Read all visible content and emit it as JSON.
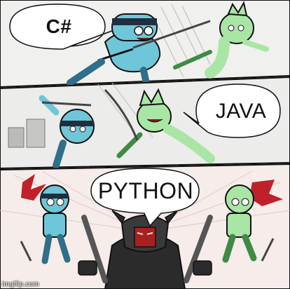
{
  "panels": [
    {
      "bubble_text": "C#"
    },
    {
      "bubble_text": "JAVA"
    },
    {
      "bubble_text": "PYTHON"
    }
  ],
  "watermark": "imgflip.com",
  "colors": {
    "panel_top_bg": "#f0f0ee",
    "panel_mid_bg": "#ececea",
    "panel_bottom_bg": "#f6ece9",
    "blue_character": "#6fc6d8",
    "blue_character_dark": "#2f6f8a",
    "green_character": "#a9e6a6",
    "green_character_dark": "#3f8a44",
    "ninja_mask": "#1f2f3f",
    "blood": "#c0202a",
    "knight_armor": "#2b2b2b",
    "knight_eyes": "#d42a2a",
    "outline": "#111111"
  }
}
